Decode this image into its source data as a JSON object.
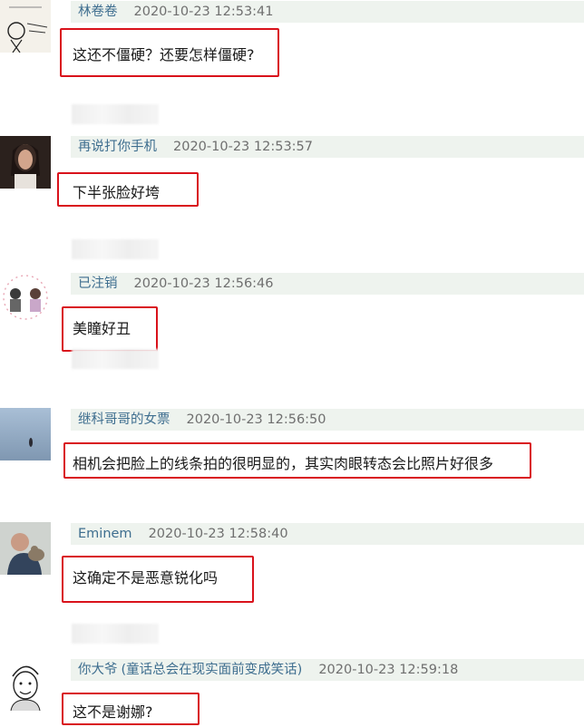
{
  "comments": [
    {
      "user": "林卷卷",
      "time": "2020-10-23 12:53:41",
      "text": "这还不僵硬？还要怎样僵硬?",
      "avatar_icon": "cartoon-sketch-avatar"
    },
    {
      "user": "再说打你手机",
      "time": "2020-10-23 12:53:57",
      "text": "下半张脸好垮",
      "avatar_icon": "photo-avatar"
    },
    {
      "user": "已注销",
      "time": "2020-10-23 12:56:46",
      "text": "美瞳好丑",
      "avatar_icon": "couple-avatar"
    },
    {
      "user": "继科哥哥的女票",
      "time": "2020-10-23 12:56:50",
      "text": "相机会把脸上的线条拍的很明显的，其实肉眼转态会比照片好很多",
      "avatar_icon": "sky-avatar"
    },
    {
      "user": "Eminem",
      "time": "2020-10-23 12:58:40",
      "text": "这确定不是恶意锐化吗",
      "avatar_icon": "man-with-cat-avatar"
    },
    {
      "user": "你大爷",
      "user_suffix": "(童话总会在现实面前变成笑话)",
      "time": "2020-10-23 12:59:18",
      "text": "这不是谢娜?",
      "avatar_icon": "cartoon-face-avatar"
    }
  ],
  "colors": {
    "highlight_border": "#d9121b",
    "meta_bg": "#eef3ee",
    "username": "#3e6e8f"
  }
}
